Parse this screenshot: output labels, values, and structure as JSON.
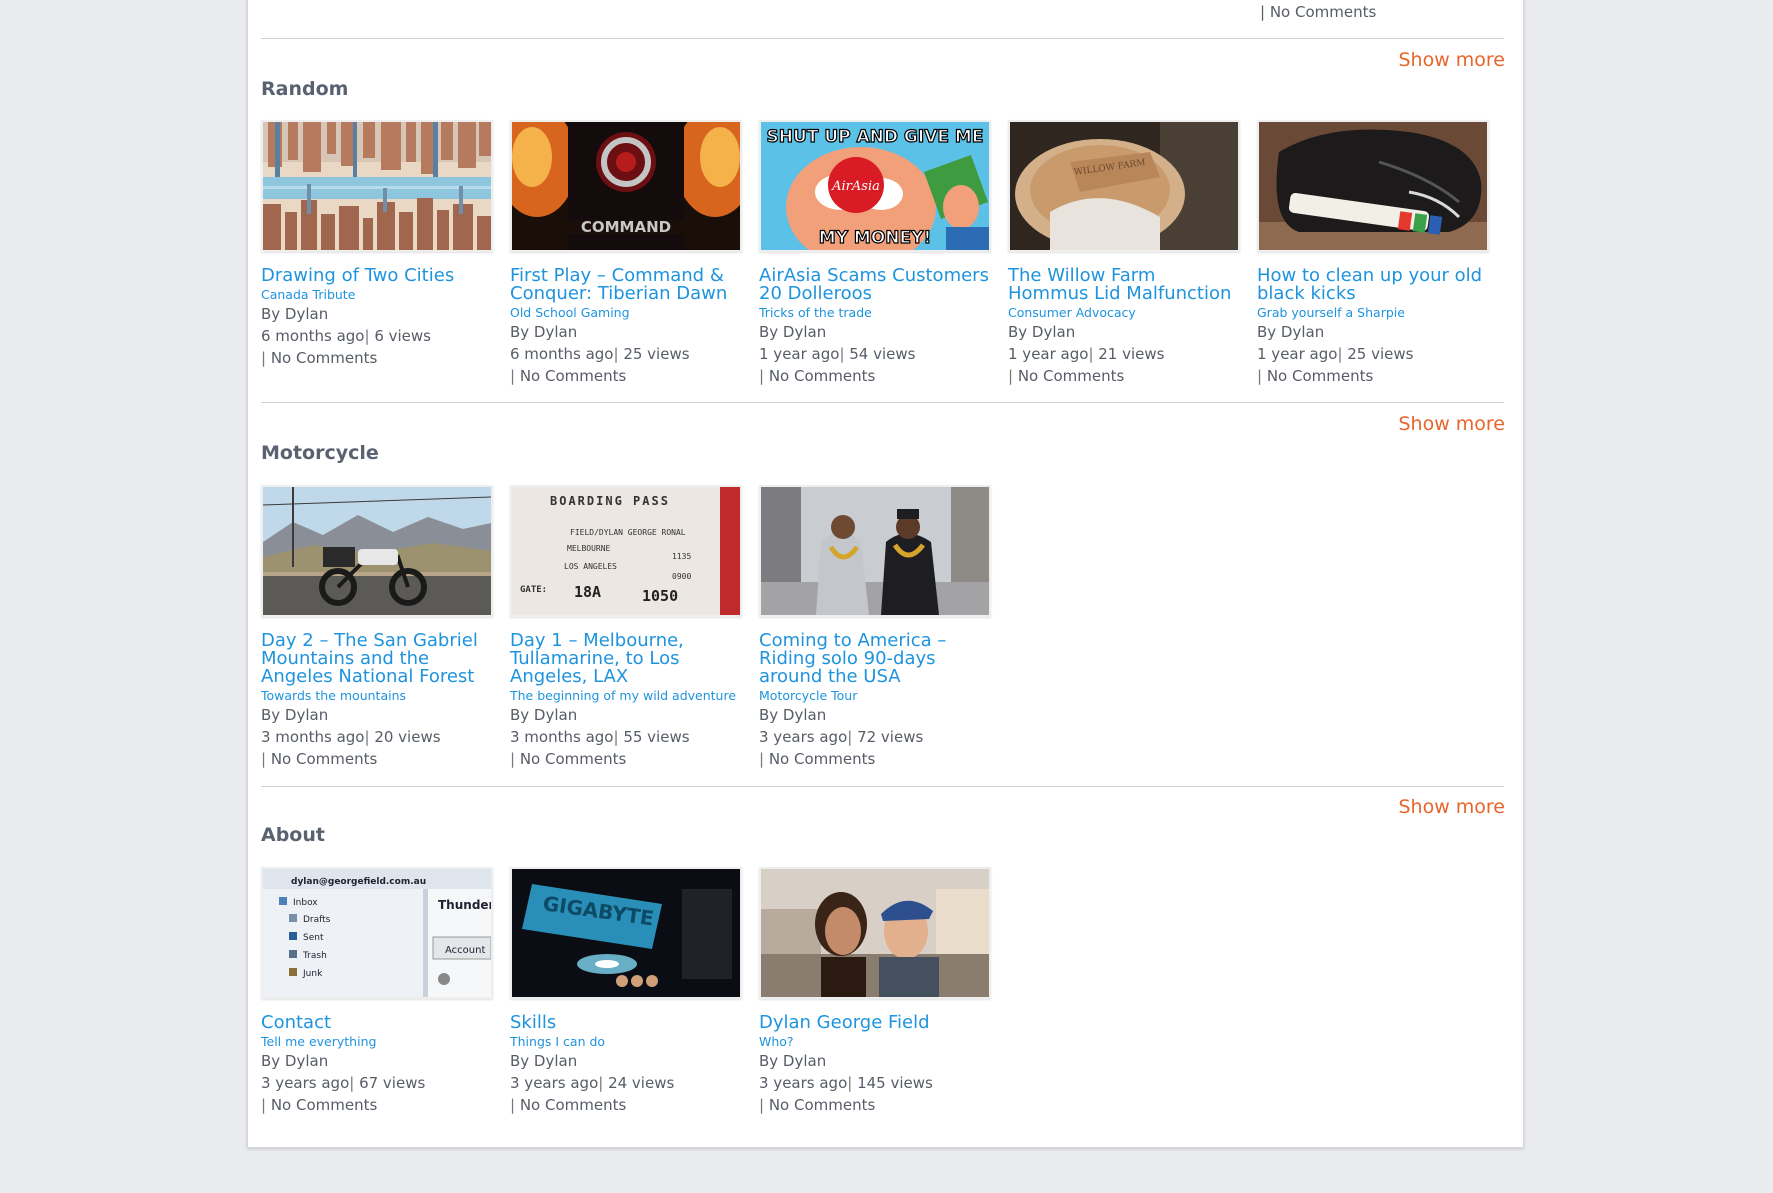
{
  "theme": {
    "link": "#1e93de",
    "accent": "#e8642c",
    "heading": "#5a6272",
    "text": "#575c66"
  },
  "top_remnant": {
    "comments": "No Comments",
    "show_more": "Show more"
  },
  "sections": [
    {
      "title": "Random",
      "show_more": "Show more",
      "posts": [
        {
          "title": "Drawing of Two Cities",
          "subtitle": "Canada Tribute",
          "author": "By Dylan",
          "age": "6 months ago",
          "views": "6 views",
          "comments": "No Comments",
          "image": "drawn-city-skyline"
        },
        {
          "title": "First Play – Command & Conquer: Tiberian Dawn",
          "subtitle": "Old School Gaming",
          "author": "By Dylan",
          "age": "6 months ago",
          "views": "25 views",
          "comments": "No Comments",
          "image": "command-and-conquer-logo"
        },
        {
          "title": "AirAsia Scams Customers 20 Dolleroos",
          "subtitle": "Tricks of the trade",
          "author": "By Dylan",
          "age": "1 year ago",
          "views": "54 views",
          "comments": "No Comments",
          "image": "shut-up-meme",
          "meme_top": "SHUT UP AND GIVE ME",
          "meme_brand": "AirAsia",
          "meme_bottom": "MY MONEY!"
        },
        {
          "title": "The Willow Farm Hommus Lid Malfunction",
          "subtitle": "Consumer Advocacy",
          "author": "By Dylan",
          "age": "1 year ago",
          "views": "21 views",
          "comments": "No Comments",
          "image": "hommus-lid"
        },
        {
          "title": "How to clean up your old black kicks",
          "subtitle": "Grab yourself a Sharpie",
          "author": "By Dylan",
          "age": "1 year ago",
          "views": "25 views",
          "comments": "No Comments",
          "image": "black-shoe-sharpie"
        }
      ]
    },
    {
      "title": "Motorcycle",
      "show_more": "Show more",
      "posts": [
        {
          "title": "Day 2 – The San Gabriel Mountains and the Angeles National Forest",
          "subtitle": "Towards the mountains",
          "author": "By Dylan",
          "age": "3 months ago",
          "views": "20 views",
          "comments": "No Comments",
          "image": "motorcycle-mountains"
        },
        {
          "title": "Day 1 – Melbourne, Tullamarine, to Los Angeles, LAX",
          "subtitle": "The beginning of my wild adventure",
          "author": "By Dylan",
          "age": "3 months ago",
          "views": "55 views",
          "comments": "No Comments",
          "image": "boarding-pass",
          "pass_heading": "BOARDING PASS",
          "pass_name": "FIELD/DYLAN GEORGE RONAL",
          "pass_from": "MELBOURNE",
          "pass_to": "LOS ANGELES",
          "pass_seat": "18A",
          "pass_time": "1050"
        },
        {
          "title": "Coming to America – Riding solo 90-days around the USA",
          "subtitle": "Motorcycle Tour",
          "author": "By Dylan",
          "age": "3 years ago",
          "views": "72 views",
          "comments": "No Comments",
          "image": "coming-to-america-still"
        }
      ]
    },
    {
      "title": "About",
      "show_more": "Show more",
      "posts": [
        {
          "title": "Contact",
          "subtitle": "Tell me everything",
          "author": "By Dylan",
          "age": "3 years ago",
          "views": "67 views",
          "comments": "No Comments",
          "image": "email-client-screen",
          "mail_address": "dylan@georgefield.com.au",
          "mail_folders": [
            "Inbox",
            "Drafts",
            "Sent",
            "Trash",
            "Junk"
          ],
          "mail_app": "Thunderl",
          "mail_button": "Account"
        },
        {
          "title": "Skills",
          "subtitle": "Things I can do",
          "author": "By Dylan",
          "age": "3 years ago",
          "views": "24 views",
          "comments": "No Comments",
          "image": "gigabyte-motherboard",
          "board_brand": "GIGABYTE"
        },
        {
          "title": "Dylan George Field",
          "subtitle": "Who?",
          "author": "By Dylan",
          "age": "3 years ago",
          "views": "145 views",
          "comments": "No Comments",
          "image": "selfie-couple"
        }
      ]
    }
  ]
}
